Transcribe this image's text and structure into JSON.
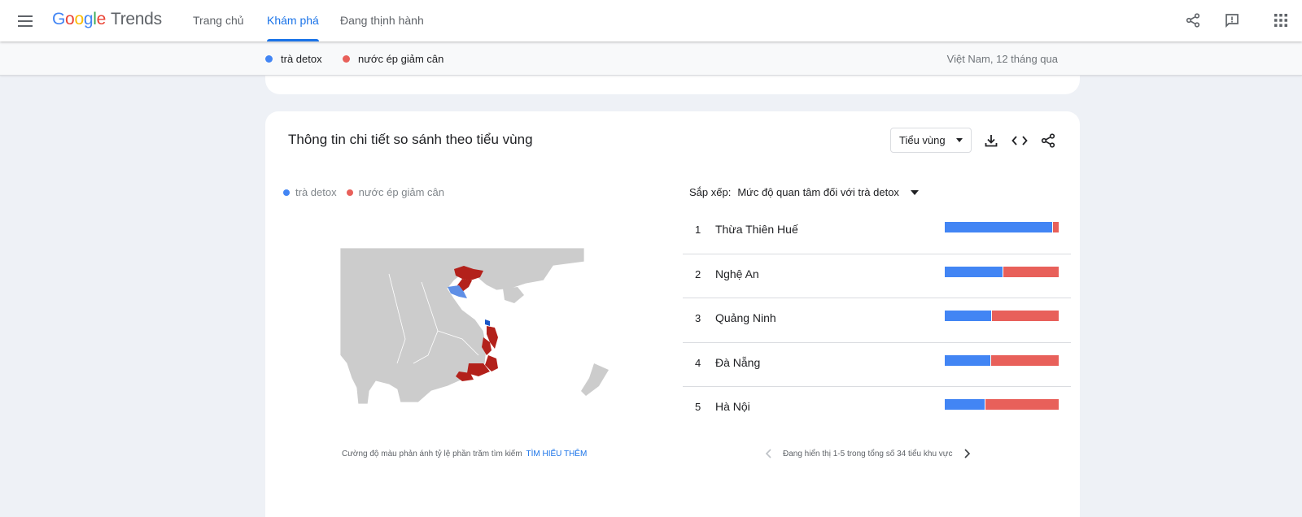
{
  "header": {
    "logo_google": [
      "G",
      "o",
      "o",
      "g",
      "l",
      "e"
    ],
    "logo_product": "Trends",
    "nav": [
      {
        "label": "Trang chủ"
      },
      {
        "label": "Khám phá"
      },
      {
        "label": "Đang thịnh hành"
      }
    ],
    "active_tab": 1
  },
  "compare_bar": {
    "terms": [
      {
        "label": "trà detox",
        "color": "#4285f4"
      },
      {
        "label": "nước ép giảm cân",
        "color": "#e8605a"
      }
    ],
    "scope": "Việt Nam, 12 tháng qua"
  },
  "card": {
    "title": "Thông tin chi tiết so sánh theo tiểu vùng",
    "region_select": "Tiểu vùng",
    "legend": [
      {
        "label": "trà detox",
        "color": "#4285f4"
      },
      {
        "label": "nước ép giảm cân",
        "color": "#e8605a"
      }
    ],
    "sort_label": "Sắp xếp:",
    "sort_value": "Mức độ quan tâm đối với trà detox",
    "ranking": [
      {
        "rank": "1",
        "name": "Thừa Thiên Huế",
        "share_a": 0.94,
        "share_b": 0.06
      },
      {
        "rank": "2",
        "name": "Nghệ An",
        "share_a": 0.51,
        "share_b": 0.49
      },
      {
        "rank": "3",
        "name": "Quảng Ninh",
        "share_a": 0.41,
        "share_b": 0.59
      },
      {
        "rank": "4",
        "name": "Đà Nẵng",
        "share_a": 0.4,
        "share_b": 0.6
      },
      {
        "rank": "5",
        "name": "Hà Nội",
        "share_a": 0.35,
        "share_b": 0.65
      }
    ],
    "map_note": "Cường độ màu phản ánh tỷ lệ phần trăm tìm kiếm",
    "map_note_link": "TÌM HIỂU THÊM",
    "pager_text": "Đang hiển thị 1-5 trong tổng số 34 tiểu khu vực"
  },
  "colors": {
    "accent": "#1a73e8",
    "series_a": "#4285f4",
    "series_b": "#e8605a",
    "map_land": "#cccccc",
    "map_region_b": "#b3211b"
  }
}
